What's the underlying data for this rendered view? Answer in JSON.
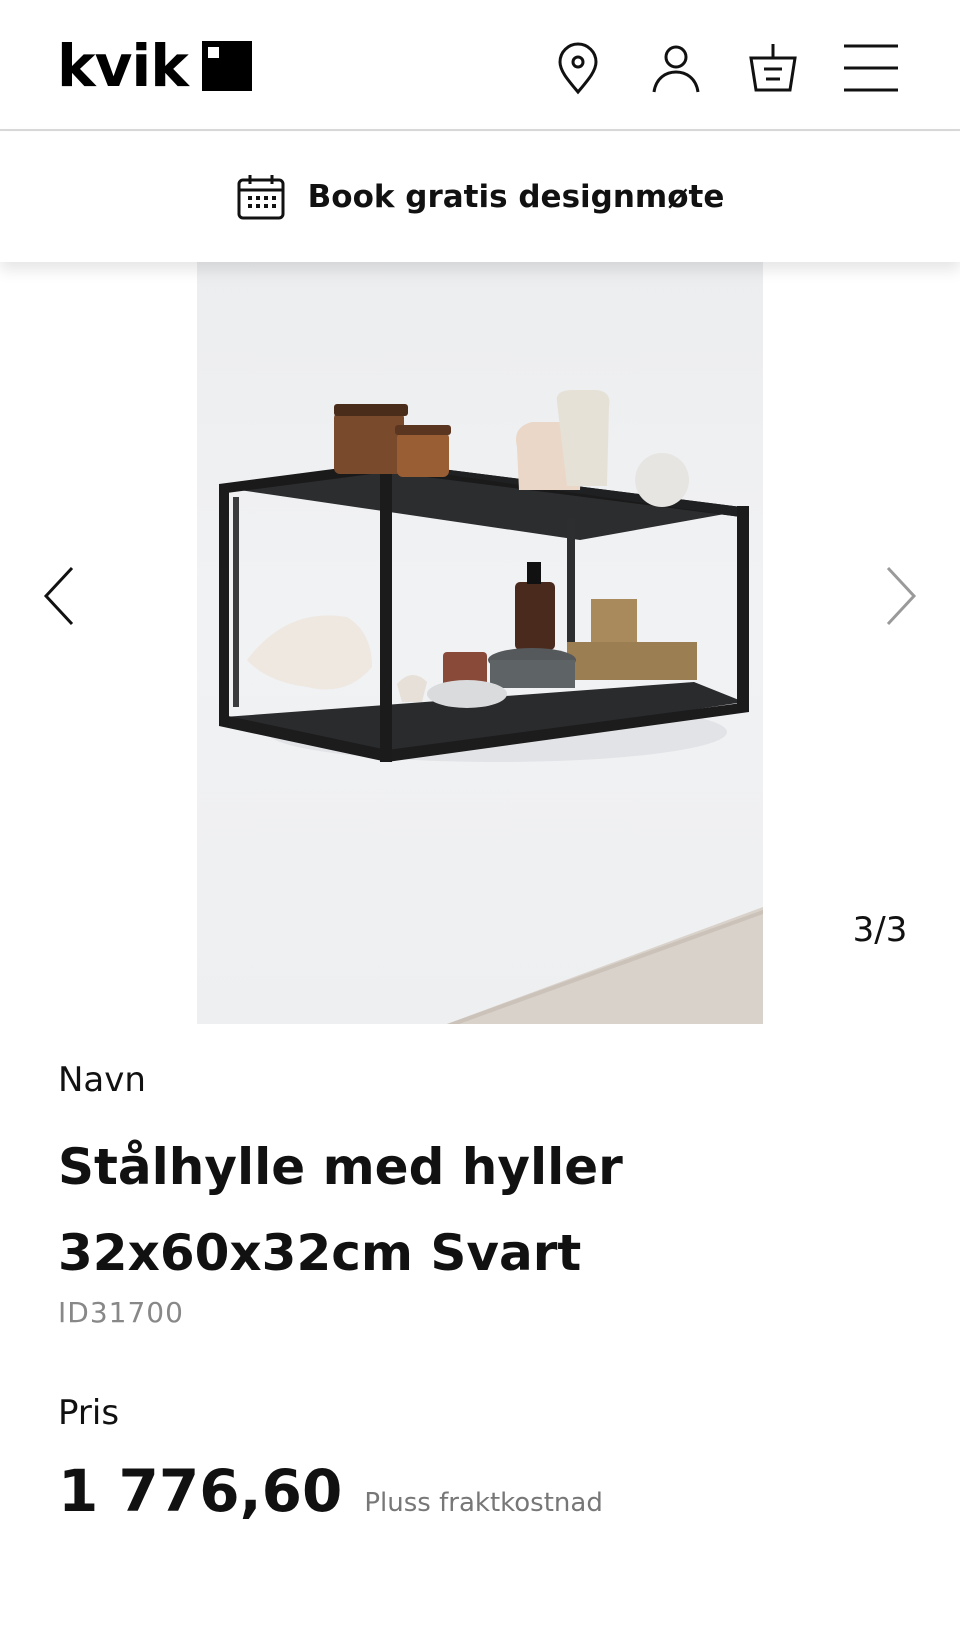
{
  "header": {
    "logo_text": "kvik",
    "icons": [
      "location-pin-icon",
      "user-icon",
      "basket-icon",
      "hamburger-menu-icon"
    ]
  },
  "banner": {
    "icon": "calendar-icon",
    "label": "Book gratis designmøte"
  },
  "gallery": {
    "counter": "3/3",
    "prev_icon": "chevron-left-icon",
    "next_icon": "chevron-right-icon"
  },
  "product": {
    "name_label": "Navn",
    "title_line1": "Stålhylle med hyller",
    "title_line2": "32x60x32cm Svart",
    "id": "ID31700",
    "price_label": "Pris",
    "price": "1 776,60",
    "shipping_note": "Pluss fraktkostnad"
  },
  "colors": {
    "text": "#111111",
    "muted": "#888888",
    "divider": "#d9d9d9"
  }
}
